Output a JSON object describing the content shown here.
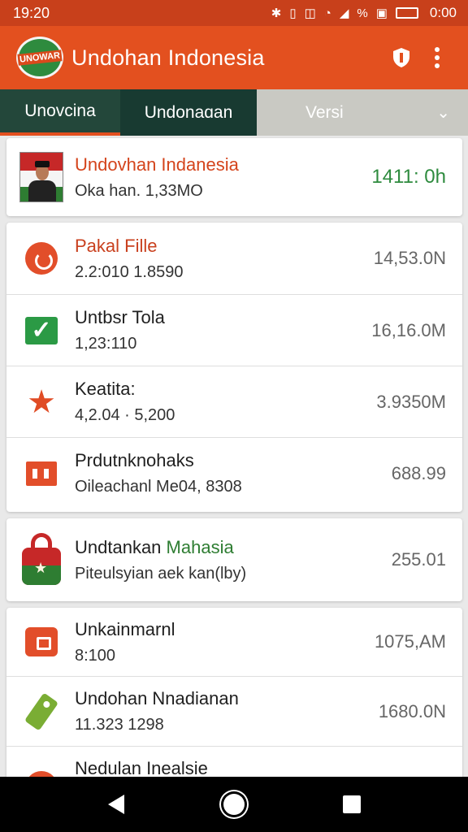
{
  "status_bar": {
    "time": "19:20",
    "icons": [
      "bluetooth-icon",
      "vibrate-icon",
      "nfc-icon",
      "wifi-icon",
      "signal-icon",
      "percent-icon",
      "notification-icon",
      "battery-icon"
    ],
    "percent_glyph": "%",
    "clock_right": "0:00"
  },
  "app_bar": {
    "logo_text": "UNOWAR",
    "title": "Undohan Indonesia"
  },
  "tabs": [
    {
      "label": "Unovcina"
    },
    {
      "label": "Undonaɑan"
    },
    {
      "label": "Versi"
    }
  ],
  "header_card": {
    "title": "Undovhan Indanesia",
    "subtitle": "Oka han. 1,33MO",
    "value": "1411: 0h",
    "title_color": "#d4441c",
    "value_color": "#2e8b3e"
  },
  "list1": [
    {
      "title": "Pakal Fille",
      "subtitle": "2.2:010 1.8590",
      "value": "14,53.0N",
      "icon": "circle-arrow-icon",
      "title_color": "#c9401e"
    },
    {
      "title": "Untbsr Tola",
      "subtitle": "1,23:110",
      "value": "16,16.0M",
      "icon": "check-icon"
    },
    {
      "title": "Keatita:",
      "subtitle": "4,2.04 · 5,200",
      "value": "3.9350M",
      "icon": "star-icon"
    },
    {
      "title": "Prdutnknohaks",
      "subtitle": "Oileachanl Me04, 8308",
      "value": "688.99",
      "icon": "building-icon"
    }
  ],
  "card3": {
    "title": "Undtankan Mahasia",
    "subtitle": "Piteulsyian aek kan(lby)",
    "value": "255.01",
    "icon": "lock-icon",
    "title_accent": "Mahasia",
    "accent_color": "#2e7d32"
  },
  "list2": [
    {
      "title": "Unkainmarnl",
      "subtitle": "8:100",
      "value": "1075,AM",
      "icon": "bag-icon"
    },
    {
      "title": "Undohan Nnadianan",
      "subtitle": "11.323 1298",
      "value": "1680.0N",
      "icon": "tag-icon"
    },
    {
      "title": "Nedulan Inealsie",
      "subtitle": "",
      "value": "",
      "icon": "lamp-icon"
    }
  ],
  "nav_bar": {
    "buttons": [
      "back-icon",
      "home-icon",
      "recents-icon"
    ]
  }
}
